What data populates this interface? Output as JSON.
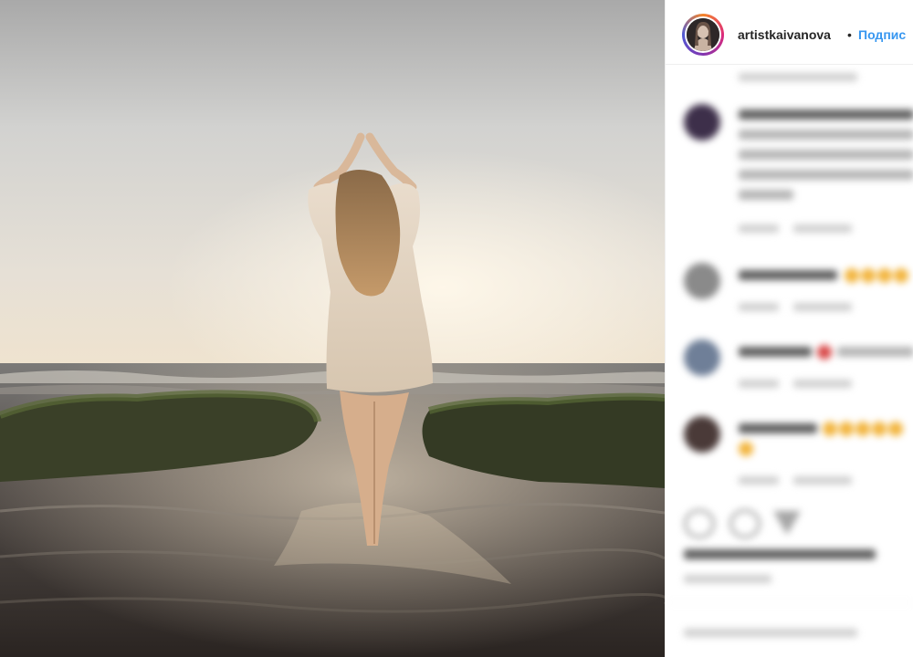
{
  "post_header": {
    "username": "artistkaivanova",
    "separator": "•",
    "follow_label": "Подпис"
  },
  "photo": {
    "description_icon": "photo-beach-woman"
  },
  "icons": {
    "like": "heart-icon",
    "comment": "comment-bubble-icon",
    "share": "paper-plane-icon"
  },
  "colors": {
    "follow": "#3897f0",
    "username": "#262626",
    "story_ring": "#dd2a7b"
  }
}
